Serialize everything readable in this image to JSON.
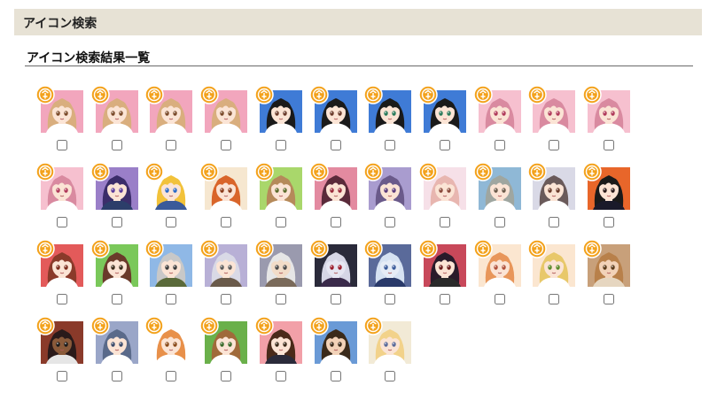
{
  "header": {
    "title": "アイコン検索"
  },
  "results": {
    "title": "アイコン検索結果一覧",
    "badge_icon": "official-badge-icon",
    "badge_color": "#f3a21c",
    "rows": [
      [
        {
          "bg": "#f2a6bd",
          "hair": "#d9ae7e",
          "skin": "#fbe4d5",
          "eye": "#7a4a2a",
          "shirt": "#ffffff",
          "checked": false
        },
        {
          "bg": "#f2a6bd",
          "hair": "#d9ae7e",
          "skin": "#fbe4d5",
          "eye": "#7a4a2a",
          "shirt": "#ffffff",
          "checked": false
        },
        {
          "bg": "#f2a6bd",
          "hair": "#d9ae7e",
          "skin": "#fbe4d5",
          "eye": "#7a4a2a",
          "shirt": "#ffffff",
          "checked": false
        },
        {
          "bg": "#f2a6bd",
          "hair": "#d9ae7e",
          "skin": "#fbe4d5",
          "eye": "#7a4a2a",
          "shirt": "#ffffff",
          "checked": false
        },
        {
          "bg": "#3f7bd6",
          "hair": "#1a1a1a",
          "skin": "#fbe4d5",
          "eye": "#6a3a2a",
          "shirt": "#ffffff",
          "checked": false
        },
        {
          "bg": "#3f7bd6",
          "hair": "#1a1a1a",
          "skin": "#fbe4d5",
          "eye": "#6a3a2a",
          "shirt": "#ffffff",
          "checked": false
        },
        {
          "bg": "#3f7bd6",
          "hair": "#1a1a1a",
          "skin": "#fbe4d5",
          "eye": "#2a7a5a",
          "shirt": "#ffffff",
          "checked": false
        },
        {
          "bg": "#3f7bd6",
          "hair": "#1a1a1a",
          "skin": "#fbe4d5",
          "eye": "#2a7a5a",
          "shirt": "#ffffff",
          "checked": false
        },
        {
          "bg": "#f6c0cf",
          "hair": "#d98aa0",
          "skin": "#fbe4d5",
          "eye": "#b03a5a",
          "shirt": "#ffffff",
          "checked": false
        },
        {
          "bg": "#f6c0cf",
          "hair": "#d98aa0",
          "skin": "#fbe4d5",
          "eye": "#b03a5a",
          "shirt": "#ffffff",
          "checked": false
        },
        {
          "bg": "#f6c0cf",
          "hair": "#d98aa0",
          "skin": "#fbe4d5",
          "eye": "#b03a5a",
          "shirt": "#ffffff",
          "checked": false
        }
      ],
      [
        {
          "bg": "#f6c0cf",
          "hair": "#d98aa0",
          "skin": "#fbe4d5",
          "eye": "#b03a5a",
          "shirt": "#ffffff",
          "checked": false
        },
        {
          "bg": "#9a7fc8",
          "hair": "#3b2d6a",
          "skin": "#fbe4d5",
          "eye": "#5a3a9a",
          "shirt": "#2c3e6a",
          "checked": false
        },
        {
          "bg": "#ffffff",
          "hair": "#f2c23a",
          "skin": "#fbe4d5",
          "eye": "#2a6ac8",
          "shirt": "#3a5a9a",
          "checked": false
        },
        {
          "bg": "#f6e7d0",
          "hair": "#d9652a",
          "skin": "#fbe4d5",
          "eye": "#8a3a1a",
          "shirt": "#ffffff",
          "checked": false
        },
        {
          "bg": "#a9d76b",
          "hair": "#b58a5a",
          "skin": "#fbe4d5",
          "eye": "#5a6a2a",
          "shirt": "#ffffff",
          "checked": false
        },
        {
          "bg": "#e38aa0",
          "hair": "#5a2a3a",
          "skin": "#fbe4d5",
          "eye": "#9a2a3a",
          "shirt": "#ffffff",
          "checked": false
        },
        {
          "bg": "#a99ccf",
          "hair": "#6a5a8a",
          "skin": "#fbe4d5",
          "eye": "#5a3a7a",
          "shirt": "#ffffff",
          "checked": false
        },
        {
          "bg": "#f6e0e8",
          "hair": "#e8b6b0",
          "skin": "#fbe4d5",
          "eye": "#8a4a3a",
          "shirt": "#ffffff",
          "checked": false
        },
        {
          "bg": "#8fb8d6",
          "hair": "#9fa6a0",
          "skin": "#fbe4d5",
          "eye": "#6a5a4a",
          "shirt": "#ffffff",
          "checked": false
        },
        {
          "bg": "#d9d9e6",
          "hair": "#6a5a5a",
          "skin": "#fbe4d5",
          "eye": "#6a3a2a",
          "shirt": "#ffffff",
          "checked": false
        },
        {
          "bg": "#e8662a",
          "hair": "#1a1a1a",
          "skin": "#fbe4d5",
          "eye": "#2a1a1a",
          "shirt": "#1a1a2a",
          "checked": false
        }
      ],
      [
        {
          "bg": "#e35a5a",
          "hair": "#8a3a2a",
          "skin": "#fbe4d5",
          "eye": "#7a2a1a",
          "shirt": "#ffffff",
          "checked": false
        },
        {
          "bg": "#7ac85a",
          "hair": "#6a3a2a",
          "skin": "#fbe4d5",
          "eye": "#3a2a1a",
          "shirt": "#ffffff",
          "checked": false
        },
        {
          "bg": "#8fb8e6",
          "hair": "#c8c8c8",
          "skin": "#fbe4d5",
          "eye": "#3a3a3a",
          "shirt": "#5a6a3a",
          "checked": false
        },
        {
          "bg": "#b8b0d6",
          "hair": "#d9d9e6",
          "skin": "#fbe4d5",
          "eye": "#5a5a5a",
          "shirt": "#6a5a4a",
          "checked": false
        },
        {
          "bg": "#9a9aae",
          "hair": "#e6e6e6",
          "skin": "#f2dcc8",
          "eye": "#4a4a4a",
          "shirt": "#7a6a5a",
          "checked": false
        },
        {
          "bg": "#2a2a3a",
          "hair": "#d6d6e6",
          "skin": "#e6e6f2",
          "eye": "#9a1a2a",
          "shirt": "#3a2a4a",
          "checked": false
        },
        {
          "bg": "#5a6a9a",
          "hair": "#d6e2f2",
          "skin": "#e6ecf6",
          "eye": "#3a5a9a",
          "shirt": "#2a3a6a",
          "checked": false
        },
        {
          "bg": "#c8485a",
          "hair": "#2a1a2a",
          "skin": "#fbe4d5",
          "eye": "#6a1a1a",
          "shirt": "#2a2a2a",
          "checked": false
        },
        {
          "bg": "#fbe6d0",
          "hair": "#e8965a",
          "skin": "#fbe4d5",
          "eye": "#b0503a",
          "shirt": "#ffffff",
          "checked": false
        },
        {
          "bg": "#fbe6d0",
          "hair": "#e8c86a",
          "skin": "#fbe4d5",
          "eye": "#5a8a2a",
          "shirt": "#ffffff",
          "checked": false
        },
        {
          "bg": "#c8a07a",
          "hair": "#b8804a",
          "skin": "#f2d2b8",
          "eye": "#5a3a1a",
          "shirt": "#e6d6c0",
          "checked": false
        }
      ],
      [
        {
          "bg": "#8a3a2a",
          "hair": "#2a1a1a",
          "skin": "#8a5a3a",
          "eye": "#1a1a1a",
          "shirt": "#e6e6e6",
          "checked": false
        },
        {
          "bg": "#9aa6c8",
          "hair": "#5a6a8a",
          "skin": "#fbe4d5",
          "eye": "#3a4a6a",
          "shirt": "#ffffff",
          "checked": false
        },
        {
          "bg": "#ffffff",
          "hair": "#e8904a",
          "skin": "#fbe4d5",
          "eye": "#8a4a1a",
          "shirt": "#ffffff",
          "checked": false
        },
        {
          "bg": "#6ab04a",
          "hair": "#a06a3a",
          "skin": "#fbe4d5",
          "eye": "#3a6a2a",
          "shirt": "#ffffff",
          "checked": false
        },
        {
          "bg": "#f2a0a8",
          "hair": "#4a2a1a",
          "skin": "#fbe4d5",
          "eye": "#3a2a1a",
          "shirt": "#2a2a3a",
          "checked": false
        },
        {
          "bg": "#6a9ad6",
          "hair": "#3a2a1a",
          "skin": "#f2d2b8",
          "eye": "#3a2a1a",
          "shirt": "#ffffff",
          "checked": false
        },
        {
          "bg": "#f2ead6",
          "hair": "#f2d28a",
          "skin": "#fbe4d5",
          "eye": "#5a6a9a",
          "shirt": "#ffffff",
          "checked": false
        }
      ]
    ]
  }
}
